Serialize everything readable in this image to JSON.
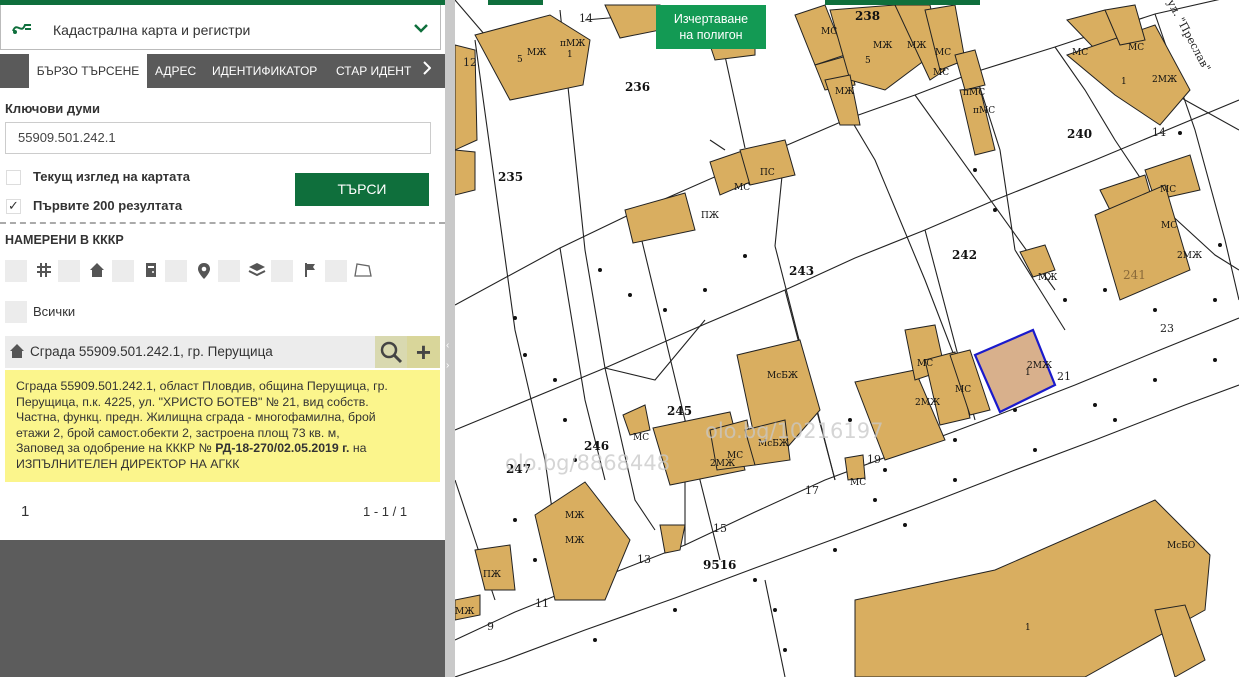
{
  "panel": {
    "title": "Кадастрална карта и регистри",
    "tabs": [
      "БЪРЗО ТЪРСЕНЕ",
      "АДРЕС",
      "ИДЕНТИФИКАТОР",
      "СТАР ИДЕНТ"
    ],
    "keywords_label": "Ключови думи",
    "keywords_value": "55909.501.242.1",
    "opt_current_view": "Текущ изглед на картата",
    "opt_first_200": "Първите 200 резултата",
    "opt_first_200_checked": true,
    "search_button": "ТЪРСИ",
    "found_header": "НАМЕРЕНИ В КККР",
    "filter_icons": [
      "parcel-grid-icon",
      "building-icon",
      "unit-icon",
      "location-pin-icon",
      "layers-icon",
      "flag-icon",
      "polygon-icon"
    ],
    "all_label": "Всички",
    "result_title": "Сграда 55909.501.242.1, гр. Перущица",
    "result_desc_lines": [
      "Сграда 55909.501.242.1, област Пловдив, община Перущица, гр.",
      "Перущица, п.к. 4225, ул. \"ХРИСТО БОТЕВ\" № 21, вид собств.",
      "Частна, функц. предн. Жилищна сграда - многофамилна, брой",
      "етажи 2, брой самост.обекти 2, застроена площ 73 кв. м,"
    ],
    "result_desc_approval": "Заповед за одобрение на КККР №",
    "result_desc_order": "РД-18-270/02.05.2019 г.",
    "result_desc_after": "на",
    "result_desc_last": "ИЗПЪЛНИТЕЛЕН ДИРЕКТОР НА АГКК",
    "page_number": "1",
    "page_range": "1 - 1 / 1"
  },
  "map": {
    "polygon_button_line1": "Изчертаване",
    "polygon_button_line2": "на полигон",
    "selected_fill": "#d8b08c",
    "building_fill": "#d9ae60",
    "accent": "#0f6f3c",
    "parcel_labels": [
      "236",
      "238",
      "235",
      "240",
      "242",
      "243",
      "241",
      "245",
      "246",
      "247",
      "9516"
    ],
    "street_label": "ул. \"Преслав\"",
    "watermarks": [
      "olo.bg/10216197",
      "olo.bg/8868448"
    ],
    "house_numbers": [
      "14",
      "12",
      "23",
      "21",
      "19",
      "17",
      "15",
      "13",
      "11",
      "9"
    ],
    "building_tags": [
      "МЖ",
      "пМЖ",
      "МС",
      "ПС",
      "ПЖ",
      "2МЖ",
      "МсБЖ",
      "МсБО",
      "пМС"
    ]
  }
}
